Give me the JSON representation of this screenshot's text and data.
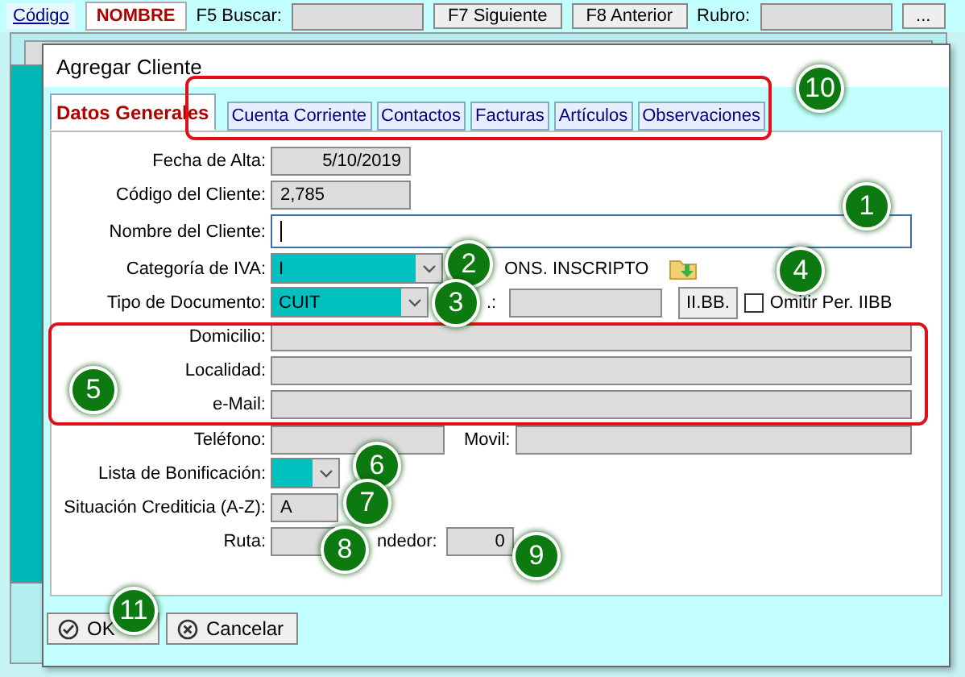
{
  "app": {
    "toolbar": [
      {
        "kind": "link",
        "label": "Código"
      },
      {
        "kind": "tab",
        "label": "NOMBRE"
      },
      {
        "kind": "label",
        "label": "F5 Buscar:"
      },
      {
        "kind": "field"
      },
      {
        "kind": "button",
        "label": "F7 Siguiente"
      },
      {
        "kind": "button",
        "label": "F8 Anterior"
      },
      {
        "kind": "label",
        "label": "Rubro:"
      },
      {
        "kind": "field"
      },
      {
        "kind": "button",
        "label": "..."
      }
    ]
  },
  "dialog": {
    "title": "Agregar Cliente",
    "tabs": [
      {
        "label": "Datos Generales",
        "selected": true
      },
      {
        "label": "Cuenta Corriente",
        "selected": false
      },
      {
        "label": "Contactos",
        "selected": false
      },
      {
        "label": "Facturas",
        "selected": false
      },
      {
        "label": "Artículos",
        "selected": false
      },
      {
        "label": "Observaciones",
        "selected": false
      }
    ],
    "form": {
      "fecha_de_alta": {
        "label": "Fecha de Alta:",
        "value": "5/10/2019"
      },
      "codigo": {
        "label": "Código del Cliente:",
        "value": "2,785"
      },
      "nombre": {
        "label": "Nombre del Cliente:",
        "focused": true
      },
      "categoria_iva": {
        "label": "Categoría de IVA:",
        "value": "I",
        "description": "ONS. INSCRIPTO"
      },
      "tipo_documento": {
        "label": "Tipo de Documento:",
        "value": "CUIT",
        "number_label": ".:",
        "iibb_button": "II.BB.",
        "omitir": {
          "label": "Omitir Per. IIBB",
          "checked": false
        }
      },
      "domicilio": {
        "label": "Domicilio:"
      },
      "localidad": {
        "label": "Localidad:"
      },
      "email": {
        "label": "e-Mail:"
      },
      "telefono": {
        "label": "Teléfono:"
      },
      "movil": {
        "label": "Movil:"
      },
      "lista_bonificacion": {
        "label": "Lista de Bonificación:"
      },
      "situacion_crediticia": {
        "label": "Situación Crediticia (A-Z):",
        "value": "A"
      },
      "ruta": {
        "label": "Ruta:"
      },
      "vendedor": {
        "label": "ndedor:",
        "value": "0"
      }
    },
    "buttons": [
      {
        "kind": "ok",
        "label": "OK"
      },
      {
        "kind": "cancel",
        "label": "Cancelar"
      }
    ]
  },
  "callouts": [
    "1",
    "2",
    "3",
    "4",
    "5",
    "6",
    "7",
    "8",
    "9",
    "10",
    "11"
  ]
}
